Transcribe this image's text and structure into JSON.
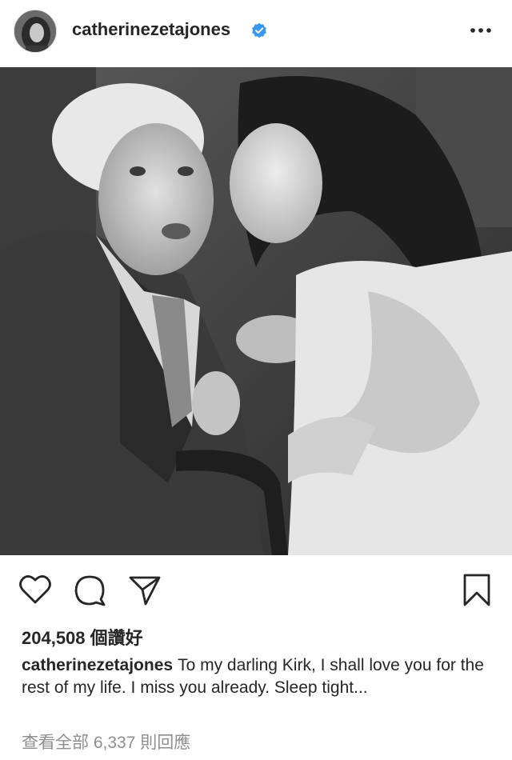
{
  "post": {
    "username": "catherinezetajones",
    "verified": true,
    "photo_description": "Black and white photo: a woman kisses an elderly man on the cheek",
    "likes_text": "204,508 個讚好",
    "caption_username": "catherinezetajones",
    "caption_text": "To my darling Kirk, I shall love you for the rest of my life. I miss you already. Sleep tight...",
    "view_comments_text": "查看全部 6,337 則回應"
  },
  "icons": {
    "more": "more-options-icon",
    "like": "heart-icon",
    "comment": "comment-icon",
    "share": "send-icon",
    "save": "bookmark-icon",
    "verified": "verified-badge-icon"
  },
  "colors": {
    "verified_blue": "#3897f0",
    "text_primary": "#262626",
    "text_secondary": "#8e8e8e"
  }
}
